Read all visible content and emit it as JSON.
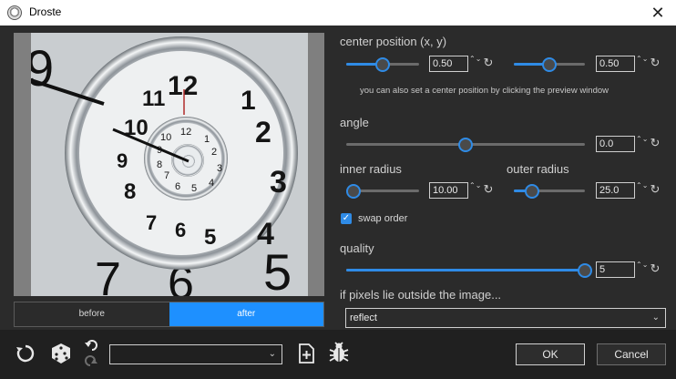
{
  "window": {
    "title": "Droste",
    "close_glyph": "✕"
  },
  "preview": {
    "before_label": "before",
    "after_label": "after",
    "active": "after",
    "clock_numerals_outer": [
      "12",
      "1",
      "2",
      "3",
      "4",
      "5",
      "6",
      "7",
      "8",
      "9",
      "10",
      "11"
    ]
  },
  "center": {
    "label": "center position (x, y)",
    "x": {
      "value": "0.50",
      "fraction": 0.5
    },
    "y": {
      "value": "0.50",
      "fraction": 0.5
    },
    "hint": "you can also set a center position by clicking the preview window"
  },
  "angle": {
    "label": "angle",
    "value": "0.0",
    "fraction": 0.5
  },
  "inner_radius": {
    "label": "inner radius",
    "value": "10.00",
    "fraction": 0.1
  },
  "outer_radius": {
    "label": "outer radius",
    "value": "25.0",
    "fraction": 0.25
  },
  "swap_order": {
    "label": "swap order",
    "checked": true
  },
  "quality": {
    "label": "quality",
    "value": "5",
    "fraction": 1.0
  },
  "outside": {
    "label": "if pixels lie outside the image...",
    "selected": "reflect"
  },
  "bottom": {
    "preset_value": "",
    "ok_label": "OK",
    "cancel_label": "Cancel"
  },
  "glyphs": {
    "spin": "⌃⌄",
    "reset": "↻",
    "check": "✓",
    "chevron": "⌄"
  },
  "colors": {
    "accent": "#2f8be6",
    "bg": "#2b2b2b"
  }
}
